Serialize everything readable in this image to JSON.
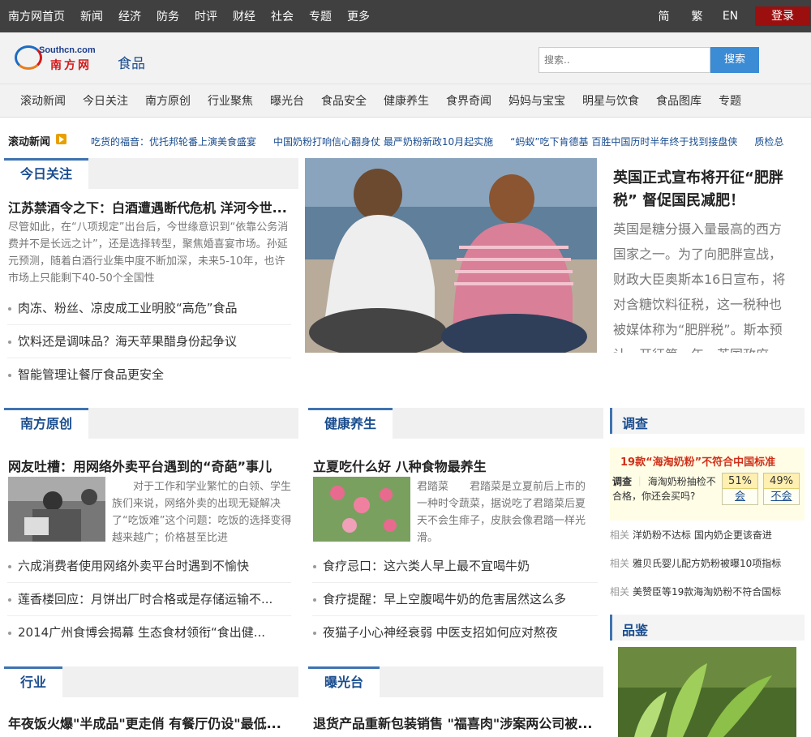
{
  "topbar": {
    "nav": [
      "南方网首页",
      "新闻",
      "经济",
      "防务",
      "时评",
      "财经",
      "社会",
      "专题",
      "更多"
    ],
    "lang": [
      "简",
      "繁",
      "EN"
    ],
    "login": "登录"
  },
  "header": {
    "logo_en": "Southcn.com",
    "logo_cn": "南方网",
    "channel": "食品",
    "search_placeholder": "搜索..",
    "search_button": "搜索"
  },
  "subnav": [
    "滚动新闻",
    "今日关注",
    "南方原创",
    "行业聚焦",
    "曝光台",
    "食品安全",
    "健康养生",
    "食界奇闻",
    "妈妈与宝宝",
    "明星与饮食",
    "食品图库",
    "专题"
  ],
  "ticker": {
    "label": "滚动新闻",
    "items": [
      "吃货的福音：优托邦轮番上演美食盛宴",
      "中国奶粉打响信心翻身仗 最严奶粉新政10月起实施",
      "“蚂蚁”吃下肯德基 百胜中国历时半年终于找到接盘侠",
      "质检总"
    ]
  },
  "today": {
    "tab": "今日关注",
    "headline": "江苏禁酒令之下：白酒遭遇断代危机 洋河今世...",
    "summary": "尽管如此，在“八项规定”出台后，今世缘意识到“依靠公务消费并不是长远之计”，还是选择转型，聚焦婚喜宴市场。孙延元预测，随着白酒行业集中度不断加深，未来5-10年，也许市场上只能剩下40-50个全国性",
    "list": [
      "肉冻、粉丝、凉皮成工业明胶“高危”食品",
      "饮料还是调味品？海天苹果醋身份起争议",
      "智能管理让餐厅食品更安全"
    ]
  },
  "feature": {
    "title": "英国正式宣布将开征“肥胖税” 督促国民减肥！",
    "text": "英国是糖分摄入量最高的西方国家之一。为了向肥胖宣战，财政大臣奥斯本16日宣布，将对含糖饮料征税，这一税种也被媒体称为“肥胖税”。斯本预计，开征第一年，英国政府"
  },
  "original": {
    "tab": "南方原创",
    "headline": "网友吐槽：用网络外卖平台遇到的“奇葩”事儿",
    "summary": "对于工作和学业繁忙的白领、学生族们来说，网络外卖的出现无疑解决了“吃饭难”这个问题：吃饭的选择变得越来越广；价格甚至比进",
    "list": [
      "六成消费者使用网络外卖平台时遇到不愉快",
      "莲香楼回应：月饼出厂时合格或是存储运输不...",
      "2014广州食博会揭幕 生态食材领衔“食出健..."
    ]
  },
  "health": {
    "tab": "健康养生",
    "headline": "立夏吃什么好 八种食物最养生",
    "summary": "君踏菜　　君踏菜是立夏前后上市的一种时令蔬菜，据说吃了君踏菜后夏天不会生痱子，皮肤会像君踏一样光滑。",
    "list": [
      "食疗忌口：这六类人早上最不宜喝牛奶",
      "食疗提醒：早上空腹喝牛奶的危害居然这么多",
      "夜猫子小心神经衰弱 中医支招如何应对熬夜"
    ]
  },
  "survey": {
    "head": "调查",
    "title": "19款“海淘奶粉”不符合中国标准",
    "question_tag": "调查",
    "question": "海淘奶粉抽检不合格，你还会买吗?",
    "yes_pct": "51%",
    "yes": "会",
    "no_pct": "49%",
    "no": "不会",
    "related": [
      {
        "tag": "相关",
        "text": "洋奶粉不达标 国内奶企更该奋进"
      },
      {
        "tag": "相关",
        "text": "雅贝氏婴儿配方奶粉被曝10项指标"
      },
      {
        "tag": "相关",
        "text": "美赞臣等19款海淘奶粉不符合国标"
      }
    ]
  },
  "tasting": {
    "head": "品鉴"
  },
  "industry": {
    "tab": "行业",
    "headline": "年夜饭火爆\"半成品\"更走俏 有餐厅仍设\"最低..."
  },
  "exposure": {
    "tab": "曝光台",
    "headline": "退货产品重新包装销售 \"福喜肉\"涉案两公司被..."
  },
  "colors": {
    "accent": "#3f73b0",
    "link": "#1a4d8f",
    "login": "#9b0f0f",
    "search": "#3b8bd5",
    "topbar": "#404040"
  }
}
